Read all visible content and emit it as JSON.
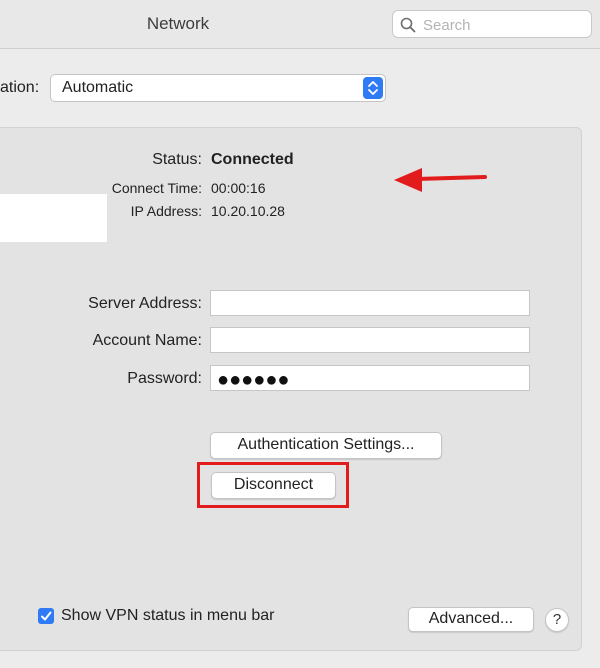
{
  "window": {
    "title": "Network"
  },
  "search": {
    "placeholder": "Search"
  },
  "location": {
    "label": "ation:",
    "value": "Automatic"
  },
  "status": {
    "status_label": "Status:",
    "status_value": "Connected",
    "connect_time_label": "Connect Time:",
    "connect_time_value": "00:00:16",
    "ip_label": "IP Address:",
    "ip_value": "10.20.10.28"
  },
  "form": {
    "server_label": "Server Address:",
    "server_value": "",
    "account_label": "Account Name:",
    "account_value": "",
    "password_label": "Password:",
    "password_mask": "●●●●●●"
  },
  "buttons": {
    "auth_settings": "Authentication Settings...",
    "disconnect": "Disconnect",
    "advanced": "Advanced...",
    "help": "?"
  },
  "options": {
    "show_vpn_status": "Show VPN status in menu bar",
    "show_vpn_status_checked": true
  },
  "colors": {
    "accent": "#2f7af5",
    "annotation_red": "#e21c1c"
  },
  "icons": [
    "search-icon",
    "stepper-icon",
    "checkmark-icon",
    "red-arrow-icon"
  ]
}
